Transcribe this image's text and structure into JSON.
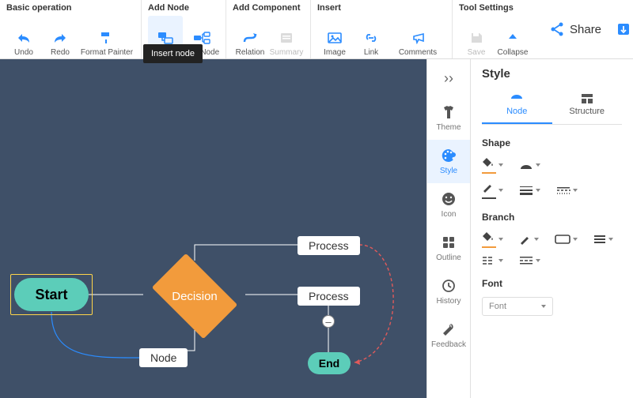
{
  "toolbar": {
    "groups": {
      "basic": {
        "title": "Basic operation",
        "undo": "Undo",
        "redo": "Redo",
        "formatPainter": "Format Painter"
      },
      "addNode": {
        "title": "Add Node",
        "node": "Node",
        "subNode": "Sub Node"
      },
      "addComponent": {
        "title": "Add Component",
        "relation": "Relation",
        "summary": "Summary"
      },
      "insert": {
        "title": "Insert",
        "image": "Image",
        "link": "Link",
        "comments": "Comments"
      },
      "toolSettings": {
        "title": "Tool Settings",
        "save": "Save",
        "collapse": "Collapse"
      }
    },
    "tooltip": "Insert node",
    "share": "Share",
    "export": "Export"
  },
  "canvas": {
    "start": "Start",
    "decision": "Decision",
    "process1": "Process",
    "process2": "Process",
    "node": "Node",
    "end": "End"
  },
  "sidetabs": {
    "collapse": "››",
    "theme": "Theme",
    "style": "Style",
    "icon": "Icon",
    "outline": "Outline",
    "history": "History",
    "feedback": "Feedback"
  },
  "panel": {
    "title": "Style",
    "tabNode": "Node",
    "tabStructure": "Structure",
    "shape": "Shape",
    "branch": "Branch",
    "font": "Font",
    "fontValue": "Font"
  }
}
